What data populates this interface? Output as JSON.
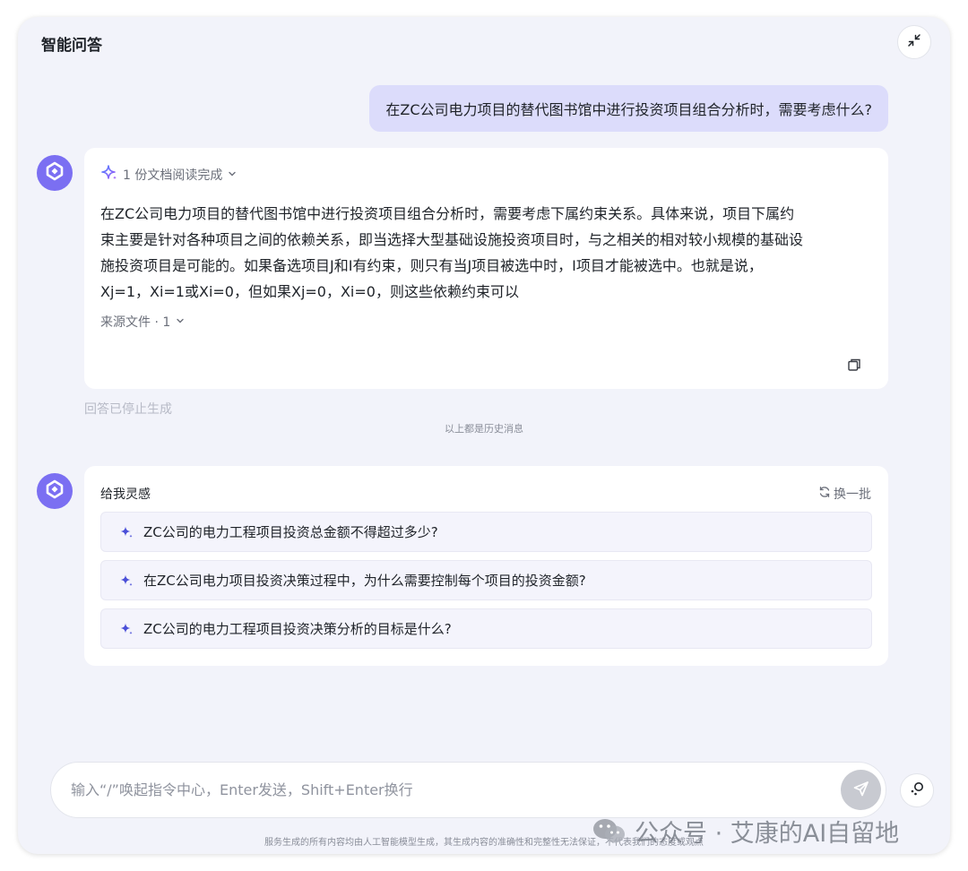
{
  "header": {
    "title": "智能问答"
  },
  "user_message": "在ZC公司电力项目的替代图书馆中进行投资项目组合分析时，需要考虑什么?",
  "answer": {
    "doc_status": "1 份文档阅读完成",
    "lines": [
      "在ZC公司电力项目的替代图书馆中进行投资项目组合分析时，需要考虑下属约束关系。具体来说，项目下属约",
      "束主要是针对各种项目之间的依赖关系，即当选择大型基础设施投资项目时，与之相关的相对较小规模的基础设",
      "施投资项目是可能的。如果备选项目J和I有约束，则只有当J项目被选中时，I项目才能被选中。也就是说，",
      "Xj=1，Xi=1或Xi=0，但如果Xj=0，Xi=0，则这些依赖约束可以"
    ],
    "source_label": "来源文件 · 1"
  },
  "stopped_note": "回答已停止生成",
  "history_note": "以上都是历史消息",
  "inspiration": {
    "title": "给我灵感",
    "refresh_label": "换一批",
    "suggestions": [
      "ZC公司的电力工程项目投资总金额不得超过多少?",
      "在ZC公司电力项目投资决策过程中，为什么需要控制每个项目的投资金额?",
      "ZC公司的电力工程项目投资决策分析的目标是什么?"
    ]
  },
  "input": {
    "placeholder": "输入“/”唤起指令中心，Enter发送，Shift+Enter换行"
  },
  "disclaimer": "服务生成的所有内容均由人工智能模型生成，其生成内容的准确性和完整性无法保证，不代表我们的态度或观点",
  "watermark": "公众号 · 艾康的AI自留地",
  "colors": {
    "accent": "#7b6ff2",
    "user_bubble": "#dcdcfb",
    "panel_bg": "#f2f3fa",
    "send_disabled": "#c8cad1"
  },
  "icons": [
    "collapse-icon",
    "bot-logo-icon",
    "sparkle-icon",
    "chevron-down-icon",
    "copy-icon",
    "refresh-icon",
    "send-icon",
    "tool-icon",
    "wechat-icon"
  ]
}
